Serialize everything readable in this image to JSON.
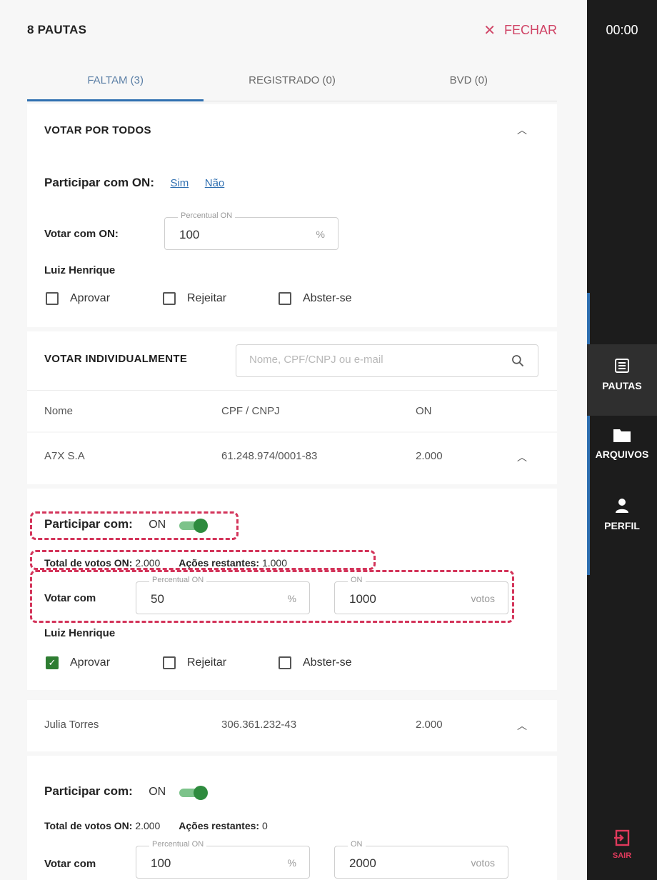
{
  "header": {
    "title": "8 PAUTAS",
    "close_label": "FECHAR"
  },
  "tabs": [
    {
      "label": "FALTAM (3)",
      "active": true
    },
    {
      "label": "REGISTRADO (0)",
      "active": false
    },
    {
      "label": "BVD (0)",
      "active": false
    }
  ],
  "vote_all": {
    "title": "VOTAR POR TODOS",
    "participate_label": "Participar com ON:",
    "yes_link": "Sim",
    "no_link": "Não",
    "vote_label": "Votar com ON:",
    "field_label": "Percentual ON",
    "field_value": "100",
    "field_unit": "%",
    "person": "Luiz Henrique",
    "options": [
      "Aprovar",
      "Rejeitar",
      "Abster-se"
    ]
  },
  "individual": {
    "title": "VOTAR INDIVIDUALMENTE",
    "search_placeholder": "Nome, CPF/CNPJ ou e-mail",
    "columns": [
      "Nome",
      "CPF / CNPJ",
      "ON"
    ],
    "rows": [
      {
        "name": "A7X S.A",
        "doc": "61.248.974/0001-83",
        "on": "2.000",
        "participate_label": "Participar com:",
        "participate_value": "ON",
        "total_label": "Total de votos ON:",
        "total_value": "2.000",
        "remaining_label": "Ações restantes:",
        "remaining_value": "1.000",
        "vote_label": "Votar com",
        "percent_label": "Percentual ON",
        "percent_value": "50",
        "percent_unit": "%",
        "on_label": "ON",
        "on_value": "1000",
        "on_unit": "votos",
        "person": "Luiz Henrique",
        "options": [
          "Aprovar",
          "Rejeitar",
          "Abster-se"
        ],
        "checked": "Aprovar"
      },
      {
        "name": "Julia Torres",
        "doc": "306.361.232-43",
        "on": "2.000",
        "participate_label": "Participar com:",
        "participate_value": "ON",
        "total_label": "Total de votos ON:",
        "total_value": "2.000",
        "remaining_label": "Ações restantes:",
        "remaining_value": "0",
        "vote_label": "Votar com",
        "percent_label": "Percentual ON",
        "percent_value": "100",
        "percent_unit": "%",
        "on_label": "ON",
        "on_value": "2000",
        "on_unit": "votos"
      }
    ]
  },
  "sidebar": {
    "time": "00:00",
    "items": [
      {
        "label": "PAUTAS",
        "icon": "list-icon",
        "active": true
      },
      {
        "label": "ARQUIVOS",
        "icon": "folder-icon",
        "active": false
      },
      {
        "label": "PERFIL",
        "icon": "user-icon",
        "active": false
      }
    ],
    "exit_label": "SAIR"
  },
  "colors": {
    "accent": "#2f6fb0",
    "danger": "#d04466",
    "toggle": "#2e8b3e",
    "sidebar": "#1c1c1c",
    "highlight": "#d3345a"
  }
}
